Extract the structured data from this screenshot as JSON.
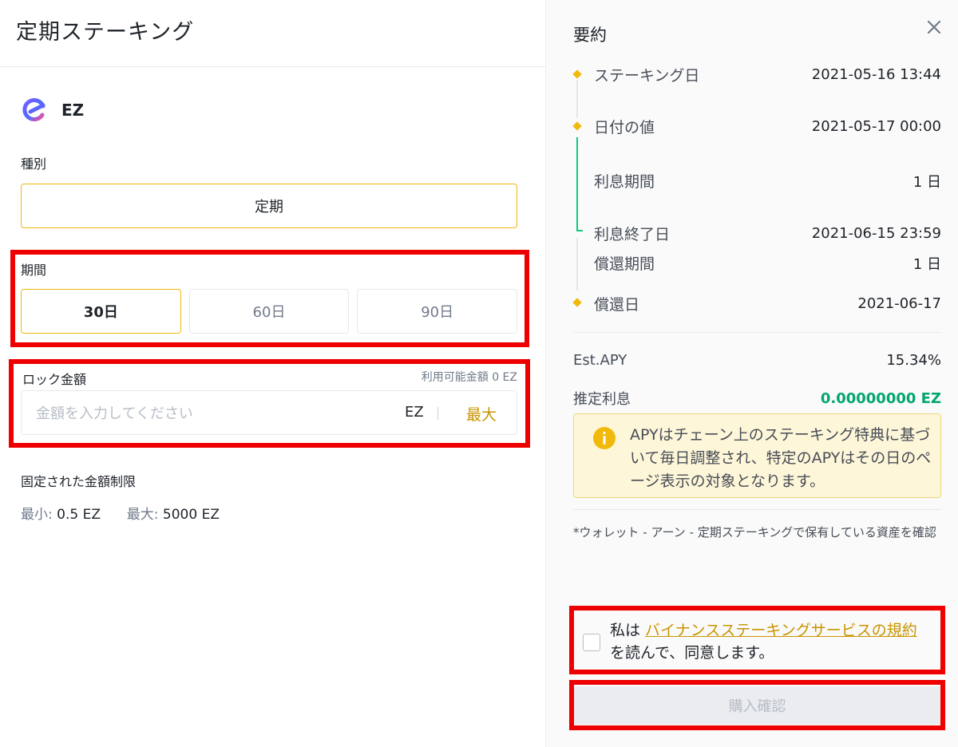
{
  "header": {
    "title": "定期ステーキング"
  },
  "coin": {
    "name": "EZ"
  },
  "type": {
    "label": "種別",
    "value": "定期"
  },
  "period": {
    "label": "期間",
    "options": [
      {
        "label": "30日",
        "selected": true
      },
      {
        "label": "60日",
        "selected": false
      },
      {
        "label": "90日",
        "selected": false
      }
    ]
  },
  "lock_amount": {
    "label": "ロック金額",
    "available": "利用可能金額 0 EZ",
    "placeholder": "金額を入力してください",
    "value": "",
    "unit": "EZ",
    "max_label": "最大"
  },
  "limits": {
    "title": "固定された金額制限",
    "min_key": "最小:",
    "min_value": "0.5 EZ",
    "max_key": "最大:",
    "max_value": "5000 EZ"
  },
  "summary": {
    "title": "要約",
    "timeline": [
      {
        "key": "ステーキング日",
        "value": "2021-05-16 13:44"
      },
      {
        "key": "日付の値",
        "value": "2021-05-17 00:00"
      },
      {
        "key": "利息期間",
        "value": "1 日"
      },
      {
        "key": "利息終了日",
        "value": "2021-06-15 23:59"
      },
      {
        "key": "償還期間",
        "value": "1 日"
      },
      {
        "key": "償還日",
        "value": "2021-06-17"
      }
    ],
    "apy_key": "Est.APY",
    "apy_value": "15.34%",
    "interest_key": "推定利息",
    "interest_value": "0.00000000 EZ",
    "notice": "APYはチェーン上のステーキング特典に基づいて毎日調整され、特定のAPYはその日のページ表示の対象となります。",
    "note": "*ウォレット - アーン - 定期ステーキングで保有している資産を確認",
    "agree_prefix": "私は ",
    "agree_link": "バイナンスステーキングサービスの規約",
    "agree_suffix": " を読んで、同意します。",
    "confirm_label": "購入確認"
  },
  "colors": {
    "accent": "#f0b90b",
    "accent_text": "#c99400",
    "green": "#03a66d",
    "highlight_red": "#ee0000"
  }
}
